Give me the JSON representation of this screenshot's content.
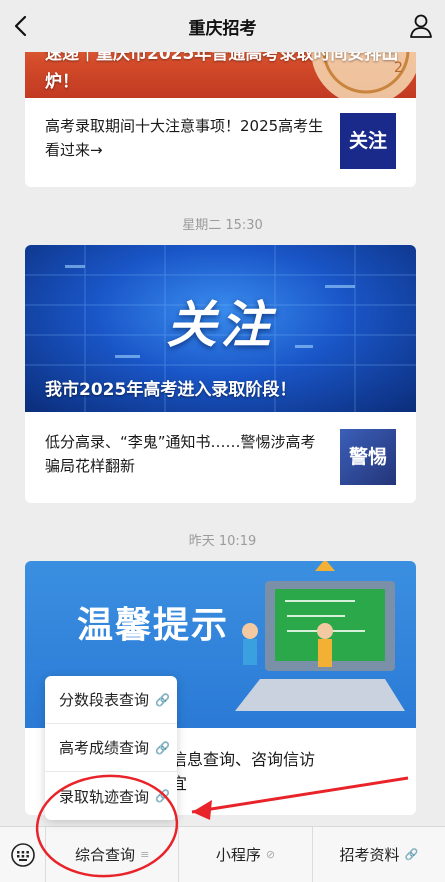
{
  "header": {
    "title": "重庆招考",
    "back_icon": "chevron-left-icon",
    "user_icon": "person-icon"
  },
  "messages": [
    {
      "banner_title": "速递｜重庆市2025年普通高考录取时间安排出炉！",
      "item_text": "高考录取期间十大注意事项！2025高考生看过来→",
      "thumb_label": "关注",
      "thumb_color": "#1a2a8a"
    },
    {
      "time": "星期二 15:30",
      "banner_word": "关注",
      "banner_title": "我市2025年高考进入录取阶段！",
      "item_text": "低分高录、“李鬼”通知书……警惕涉高考骗局花样翻新",
      "thumb_label": "警惕",
      "thumb_color": "#2a3f8a"
    },
    {
      "time": "昨天 10:19",
      "banner_word": "温馨提示",
      "item_text_partial": "询信息查询、咨询信访事宜"
    }
  ],
  "submenu": {
    "items": [
      {
        "label": "分数段表查询"
      },
      {
        "label": "高考成绩查询"
      },
      {
        "label": "录取轨迹查询"
      }
    ]
  },
  "bottom_menu": {
    "keyboard_icon": "keyboard-icon",
    "items": [
      {
        "label": "综合查询",
        "icon": "menu-lines-icon"
      },
      {
        "label": "小程序",
        "icon": "mini-program-icon"
      },
      {
        "label": "招考资料",
        "icon": "link-icon"
      }
    ]
  },
  "colors": {
    "annotation": "#e8232a",
    "banner_blue": "#1f5bd6"
  }
}
